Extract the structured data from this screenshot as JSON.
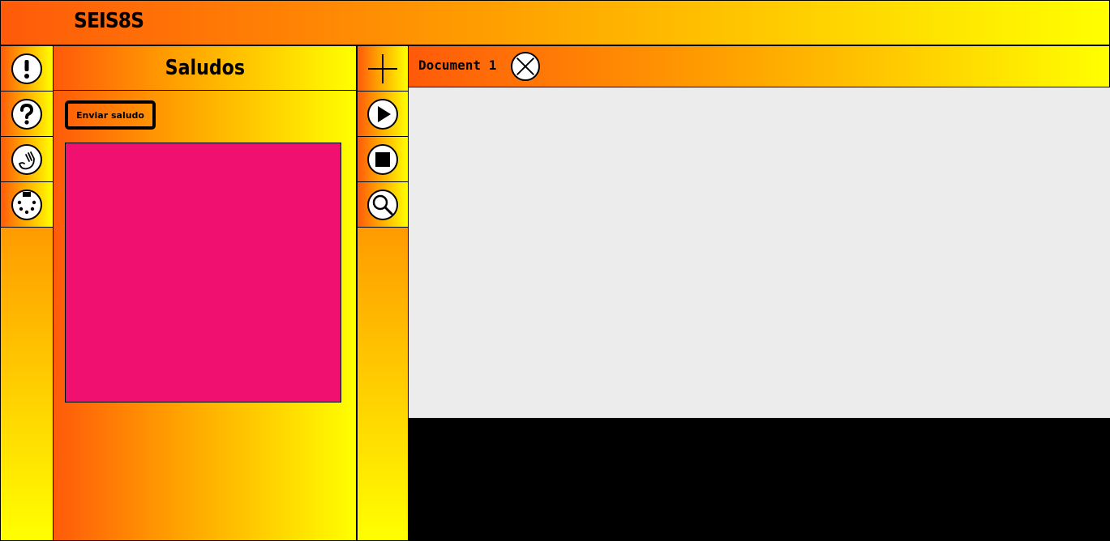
{
  "app": {
    "title": "SEIS8S"
  },
  "left_rail": {
    "items": [
      {
        "icon": "exclamation-icon"
      },
      {
        "icon": "question-icon"
      },
      {
        "icon": "hand-icon"
      },
      {
        "icon": "midi-connector-icon"
      }
    ]
  },
  "panel": {
    "title": "Saludos",
    "send_button_label": "Enviar saludo",
    "canvas_color": "#ef1070"
  },
  "tool_rail": {
    "items": [
      {
        "icon": "plus-icon"
      },
      {
        "icon": "play-icon"
      },
      {
        "icon": "stop-icon"
      },
      {
        "icon": "search-icon"
      }
    ]
  },
  "editor": {
    "tabs": [
      {
        "label": "Document 1"
      }
    ],
    "background": "#ececec",
    "console_background": "#000000"
  },
  "colors": {
    "gradient_start": "#ff5a0a",
    "gradient_mid": "#ffa000",
    "gradient_end": "#ffff00"
  }
}
